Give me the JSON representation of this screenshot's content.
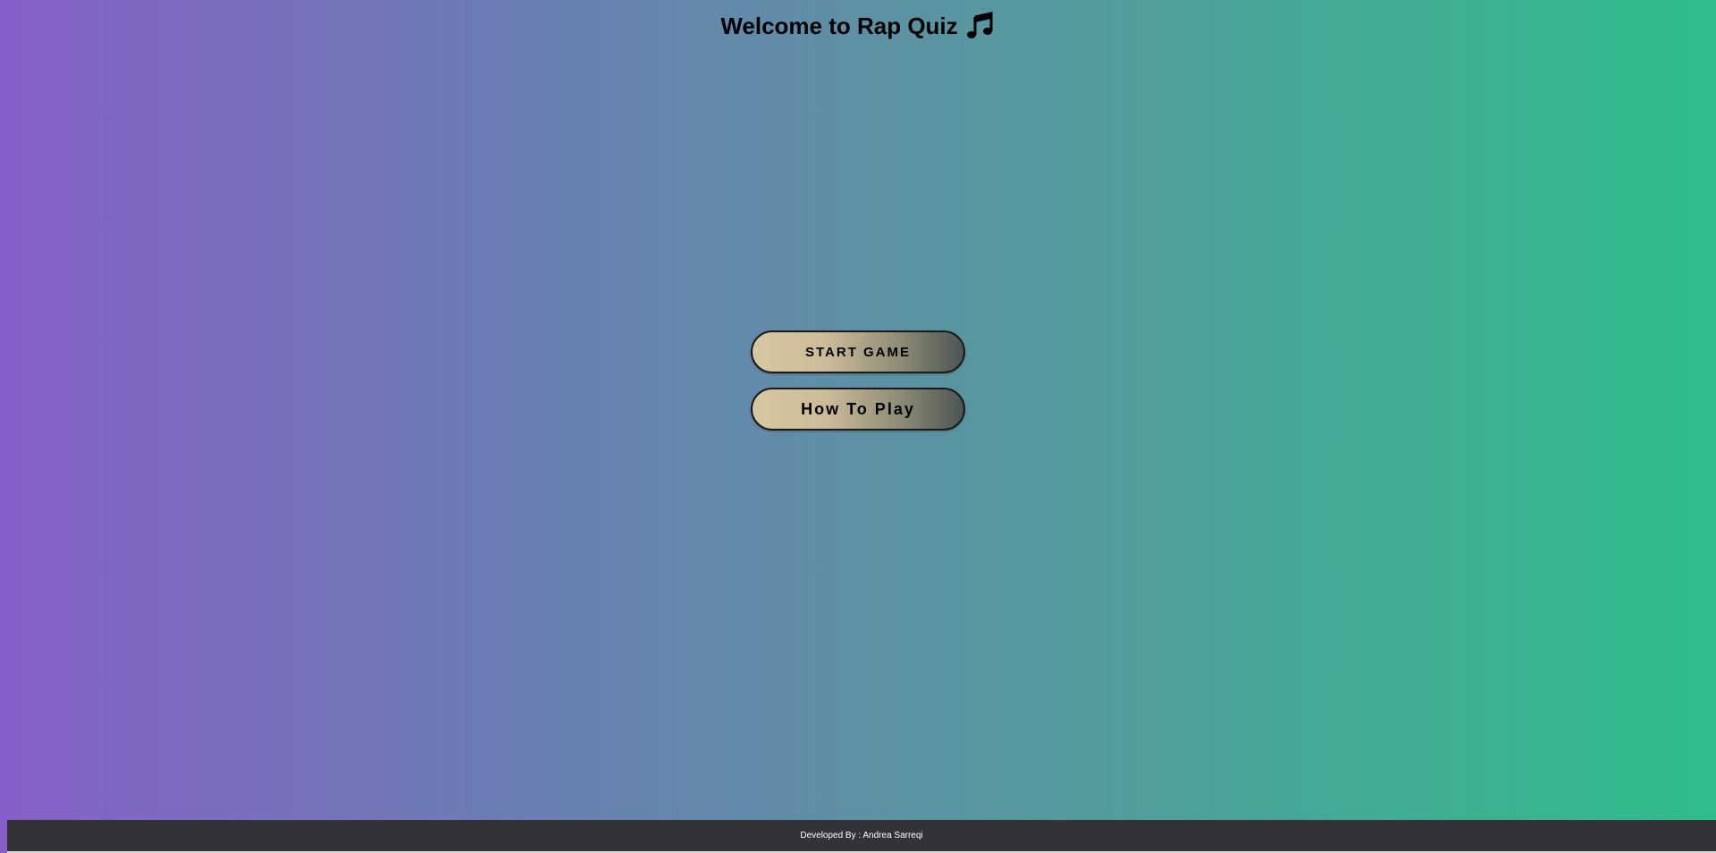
{
  "header": {
    "title": "Welcome to Rap Quiz",
    "icon": "music-notes-icon"
  },
  "menu": {
    "start_label": "START GAME",
    "howto_label": "How To Play"
  },
  "footer": {
    "credit": "Developed By : Andrea Sarreqi"
  },
  "colors": {
    "background_left": "#8660c8",
    "background_right": "#2fbd8c",
    "button_left": "#d8c7a0",
    "button_right": "#4b5552",
    "footer_bg": "#333237"
  }
}
